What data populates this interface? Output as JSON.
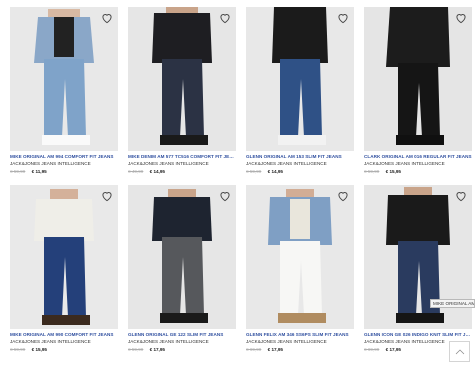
{
  "products": [
    {
      "name": "MIKE ORIGINAL AM 994 COMFORT FIT JEANS",
      "brand": "JACK&JONES JEANS INTELLIGENCE",
      "old_price": "€ 59,99",
      "price": "€ 11,95",
      "wishlist_icon": "heart-outline-icon"
    },
    {
      "name": "MIKE DENIM AM 577 TC516 COMFORT FIT JEA...",
      "brand": "JACK&JONES JEANS INTELLIGENCE",
      "old_price": "€ 49,99",
      "price": "€ 14,95",
      "wishlist_icon": "heart-outline-icon"
    },
    {
      "name": "GLENN ORIGINAL AM 153 SLIM FIT JEANS",
      "brand": "JACK&JONES JEANS INTELLIGENCE",
      "old_price": "€ 59,99",
      "price": "€ 14,95",
      "wishlist_icon": "heart-outline-icon"
    },
    {
      "name": "CLARK ORIGINAL AM 016 REGULAR FIT JEANS",
      "brand": "JACK&JONES JEANS INTELLIGENCE",
      "old_price": "€ 59,99",
      "price": "€ 15,95",
      "wishlist_icon": "heart-outline-icon"
    },
    {
      "name": "MIKE ORIGINAL AM 990 COMFORT FIT JEANS",
      "brand": "JACK&JONES JEANS INTELLIGENCE",
      "old_price": "€ 59,99",
      "price": "€ 15,95",
      "wishlist_icon": "heart-outline-icon"
    },
    {
      "name": "GLENN ORIGINAL GE 122 SLIM FIT JEANS",
      "brand": "JACK&JONES JEANS INTELLIGENCE",
      "old_price": "€ 59,99",
      "price": "€ 17,95",
      "wishlist_icon": "heart-outline-icon"
    },
    {
      "name": "GLENN FELIX AM 346 SS6PS SLIM FIT JEANS",
      "brand": "JACK&JONES JEANS INTELLIGENCE",
      "old_price": "€ 69,99",
      "price": "€ 17,95",
      "wishlist_icon": "heart-outline-icon"
    },
    {
      "name": "GLENN ICON GE 026 INDIGO KNIT SLIM FIT JEA...",
      "brand": "JACK&JONES JEANS INTELLIGENCE",
      "old_price": "€ 69,99",
      "price": "€ 17,95",
      "wishlist_icon": "heart-outline-icon"
    }
  ],
  "tooltip": {
    "text": "MIKE ORIGINAL AM I"
  },
  "scroll_top": {
    "icon": "chevron-up-icon"
  },
  "colors": {
    "product_name": "#2f4f9f",
    "old_price": "#b0b0b0",
    "price": "#222222",
    "photo_bg": "#e9e9e9"
  }
}
